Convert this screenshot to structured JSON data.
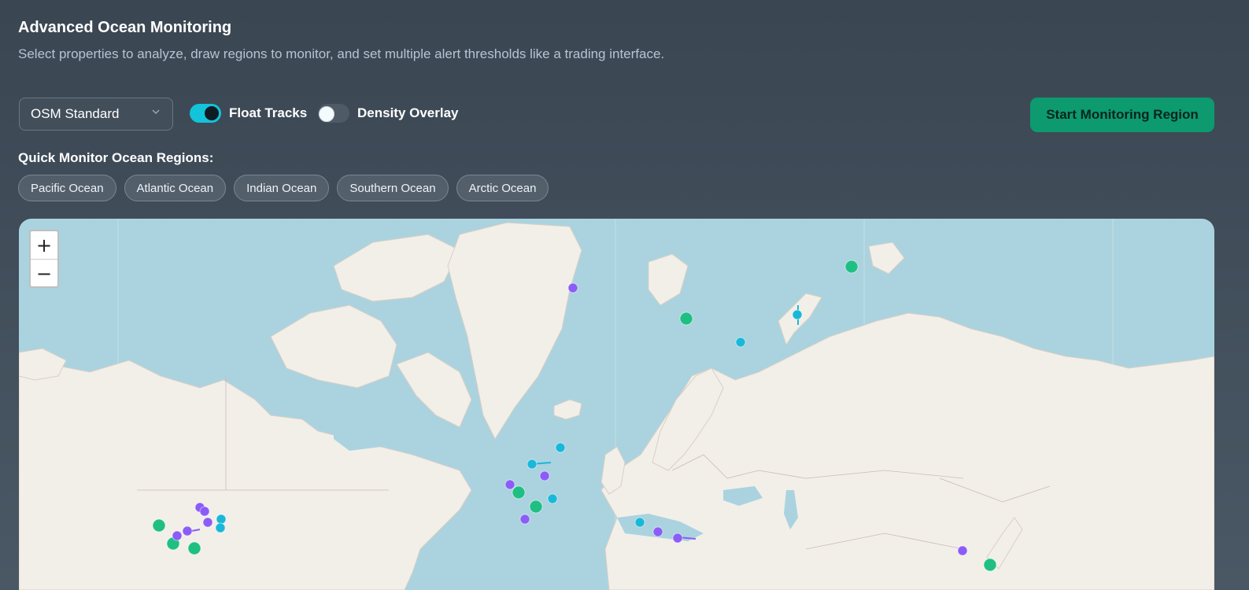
{
  "header": {
    "title": "Advanced Ocean Monitoring",
    "subtitle": "Select properties to analyze, draw regions to monitor, and set multiple alert thresholds like a trading interface."
  },
  "controls": {
    "basemap_select": "OSM Standard",
    "toggles": [
      {
        "label": "Float Tracks",
        "on": true
      },
      {
        "label": "Density Overlay",
        "on": false
      }
    ],
    "start_button": "Start Monitoring Region"
  },
  "quick": {
    "title": "Quick Monitor Ocean Regions:",
    "regions": [
      "Pacific Ocean",
      "Atlantic Ocean",
      "Indian Ocean",
      "Southern Ocean",
      "Arctic Ocean"
    ]
  },
  "map": {
    "zoom_in": "+",
    "zoom_out": "−",
    "colors": {
      "water": "#aad3df",
      "land": "#f2efe9",
      "float_green": "#1fbf83",
      "float_cyan": "#1ab8d8",
      "float_purple": "#8b5cf6"
    }
  }
}
